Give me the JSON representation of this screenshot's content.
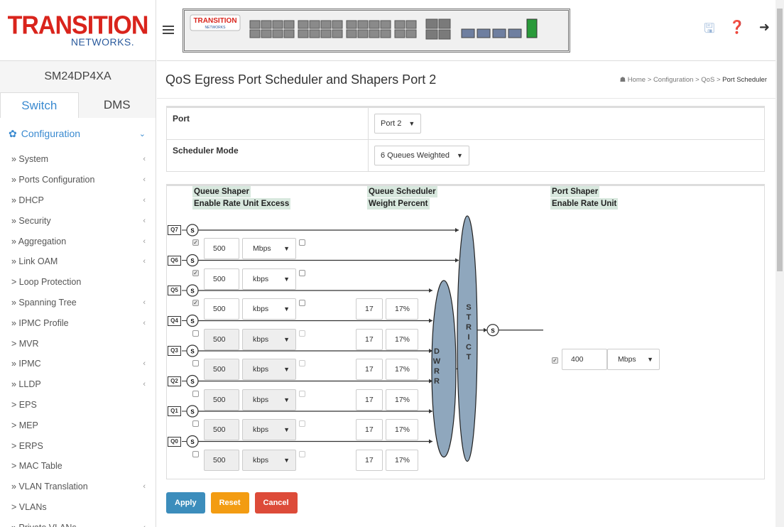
{
  "brand": {
    "logo_main": "TRANSITION",
    "logo_sub": "NETWORKS."
  },
  "device_name": "SM24DP4XA",
  "tabs": [
    {
      "label": "Switch"
    },
    {
      "label": "DMS"
    }
  ],
  "nav": {
    "section_label": "Configuration",
    "items": [
      {
        "label": "» System",
        "expandable": true
      },
      {
        "label": "» Ports Configuration",
        "expandable": true
      },
      {
        "label": "» DHCP",
        "expandable": true
      },
      {
        "label": "» Security",
        "expandable": true
      },
      {
        "label": "» Aggregation",
        "expandable": true
      },
      {
        "label": "» Link OAM",
        "expandable": true
      },
      {
        "label": "> Loop Protection",
        "expandable": false
      },
      {
        "label": "» Spanning Tree",
        "expandable": true
      },
      {
        "label": "» IPMC Profile",
        "expandable": true
      },
      {
        "label": "> MVR",
        "expandable": false
      },
      {
        "label": "» IPMC",
        "expandable": true
      },
      {
        "label": "» LLDP",
        "expandable": true
      },
      {
        "label": "> EPS",
        "expandable": false
      },
      {
        "label": "> MEP",
        "expandable": false
      },
      {
        "label": "> ERPS",
        "expandable": false
      },
      {
        "label": "> MAC Table",
        "expandable": false
      },
      {
        "label": "» VLAN Translation",
        "expandable": true
      },
      {
        "label": "> VLANs",
        "expandable": false
      },
      {
        "label": "» Private VLANs",
        "expandable": true
      }
    ]
  },
  "topbar": {
    "panel_logo": "TRANSITION",
    "panel_logo_sub": "NETWORKS"
  },
  "page": {
    "title": "QoS Egress Port Scheduler and Shapers  Port 2"
  },
  "breadcrumb": {
    "home": "Home",
    "sep": ">",
    "items": [
      "Configuration",
      "QoS"
    ],
    "current": "Port Scheduler"
  },
  "form": {
    "port_label": "Port",
    "port_value": "Port 2",
    "mode_label": "Scheduler Mode",
    "mode_value": "6 Queues Weighted"
  },
  "diagram": {
    "queue_shaper_label": "Queue Shaper",
    "queue_shaper_cols": "Enable Rate Unit Excess",
    "scheduler_label": "Queue Scheduler",
    "scheduler_cols": "Weight  Percent",
    "port_shaper_label": "Port Shaper",
    "port_shaper_cols": "Enable Rate Unit",
    "shaper_symbol": "S",
    "dwrr_label": "DWRR",
    "strict_label": "STRICT",
    "queues": [
      {
        "name": "Q7",
        "enabled": true,
        "rate": "500",
        "unit": "Mbps",
        "excess": false,
        "weight": "",
        "percent": ""
      },
      {
        "name": "Q6",
        "enabled": true,
        "rate": "500",
        "unit": "kbps",
        "excess": false,
        "weight": "",
        "percent": ""
      },
      {
        "name": "Q5",
        "enabled": true,
        "rate": "500",
        "unit": "kbps",
        "excess": false,
        "weight": "17",
        "percent": "17%"
      },
      {
        "name": "Q4",
        "enabled": false,
        "rate": "500",
        "unit": "kbps",
        "excess": false,
        "weight": "17",
        "percent": "17%"
      },
      {
        "name": "Q3",
        "enabled": false,
        "rate": "500",
        "unit": "kbps",
        "excess": false,
        "weight": "17",
        "percent": "17%"
      },
      {
        "name": "Q2",
        "enabled": false,
        "rate": "500",
        "unit": "kbps",
        "excess": false,
        "weight": "17",
        "percent": "17%"
      },
      {
        "name": "Q1",
        "enabled": false,
        "rate": "500",
        "unit": "kbps",
        "excess": false,
        "weight": "17",
        "percent": "17%"
      },
      {
        "name": "Q0",
        "enabled": false,
        "rate": "500",
        "unit": "kbps",
        "excess": false,
        "weight": "17",
        "percent": "17%"
      }
    ],
    "port_shaper": {
      "enabled": true,
      "rate": "400",
      "unit": "Mbps"
    }
  },
  "buttons": {
    "apply": "Apply",
    "reset": "Reset",
    "cancel": "Cancel"
  }
}
